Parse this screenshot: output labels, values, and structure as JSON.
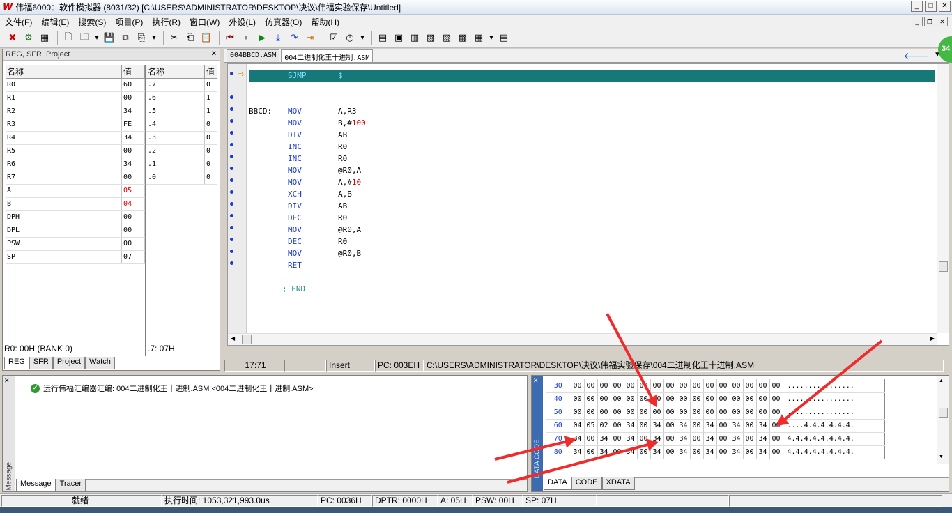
{
  "window": {
    "title": "伟福6000：软件模拟器 (8031/32) [C:\\USERS\\ADMINISTRATOR\\DESKTOP\\决议\\伟福实验保存\\Untitled]",
    "logo": "W"
  },
  "menu": [
    "文件(F)",
    "编辑(E)",
    "搜索(S)",
    "项目(P)",
    "执行(R)",
    "窗口(W)",
    "外设(L)",
    "仿真器(O)",
    "帮助(H)"
  ],
  "toolbar_icons": [
    "stop-icon",
    "gear-icon",
    "chip-icon",
    "new-file-icon",
    "open-folder-icon",
    "dropdown-icon",
    "save-icon",
    "save-all-icon",
    "project-icon",
    "dropdown-icon",
    "cut-icon",
    "copy-icon",
    "paste-icon",
    "reset-icon",
    "pause-icon",
    "run-icon",
    "step-into-icon",
    "step-over-icon",
    "run-to-cursor-icon",
    "watch-icon",
    "clock-icon",
    "dropdown-icon",
    "view-a-icon",
    "view-b-icon",
    "view-c-icon",
    "view-d-icon",
    "view-e-icon",
    "view-f-icon",
    "view-g-icon",
    "dropdown-icon",
    "view-h-icon"
  ],
  "left_panel": {
    "title": "REG, SFR, Project",
    "col_name": "名称",
    "col_value": "值",
    "registers": [
      {
        "name": "R0",
        "value": "60",
        "hl": false
      },
      {
        "name": "R1",
        "value": "00",
        "hl": false
      },
      {
        "name": "R2",
        "value": "34",
        "hl": false
      },
      {
        "name": "R3",
        "value": "FE",
        "hl": false
      },
      {
        "name": "R4",
        "value": "34",
        "hl": false
      },
      {
        "name": "R5",
        "value": "00",
        "hl": false
      },
      {
        "name": "R6",
        "value": "34",
        "hl": false
      },
      {
        "name": "R7",
        "value": "00",
        "hl": false
      },
      {
        "name": "A",
        "value": "05",
        "hl": true
      },
      {
        "name": "B",
        "value": "04",
        "hl": true
      },
      {
        "name": "DPH",
        "value": "00",
        "hl": false
      },
      {
        "name": "DPL",
        "value": "00",
        "hl": false
      },
      {
        "name": "PSW",
        "value": "00",
        "hl": false
      },
      {
        "name": "SP",
        "value": "07",
        "hl": false
      }
    ],
    "bits": [
      {
        "name": ".7",
        "value": "0"
      },
      {
        "name": ".6",
        "value": "1"
      },
      {
        "name": ".5",
        "value": "1"
      },
      {
        "name": ".4",
        "value": "0"
      },
      {
        "name": ".3",
        "value": "0"
      },
      {
        "name": ".2",
        "value": "0"
      },
      {
        "name": ".1",
        "value": "0"
      },
      {
        "name": ".0",
        "value": "0"
      }
    ],
    "status_left": "R0: 00H (BANK 0)",
    "status_right": ".7: 07H",
    "tabs": [
      "REG",
      "SFR",
      "Project",
      "Watch"
    ]
  },
  "editor": {
    "tabs": [
      "004BBCD.ASM",
      "004二进制化王十进制.ASM"
    ],
    "highlight_line": {
      "op": "SJMP",
      "arg": "$"
    },
    "label": "BBCD:",
    "lines": [
      {
        "op": "MOV",
        "a": "A,R3",
        "n": ""
      },
      {
        "op": "MOV",
        "a": "B,#",
        "n": "100"
      },
      {
        "op": "DIV",
        "a": "AB",
        "n": ""
      },
      {
        "op": "INC",
        "a": "R0",
        "n": ""
      },
      {
        "op": "INC",
        "a": "R0",
        "n": ""
      },
      {
        "op": "MOV",
        "a": "@R0,A",
        "n": ""
      },
      {
        "op": "MOV",
        "a": "A,#",
        "n": "10"
      },
      {
        "op": "XCH",
        "a": "A,B",
        "n": ""
      },
      {
        "op": "DIV",
        "a": "AB",
        "n": ""
      },
      {
        "op": "DEC",
        "a": "R0",
        "n": ""
      },
      {
        "op": "MOV",
        "a": "@R0,A",
        "n": ""
      },
      {
        "op": "DEC",
        "a": "R0",
        "n": ""
      },
      {
        "op": "MOV",
        "a": "@R0,B",
        "n": ""
      },
      {
        "op": "RET",
        "a": "",
        "n": ""
      }
    ],
    "comment": "; END"
  },
  "editor_status": {
    "pos": "17:71",
    "mode": "Insert",
    "pc": "PC: 003EH",
    "path": "C:\\USERS\\ADMINISTRATOR\\DESKTOP\\决议\\伟福实验保存\\004二进制化王十进制.ASM"
  },
  "message": {
    "text": "运行伟福汇编器汇编: 004二进制化王十进制.ASM  <004二进制化王十进制.ASM>",
    "side_label": "Message",
    "tabs": [
      "Message",
      "Tracer"
    ]
  },
  "memory": {
    "side_label": "DATA CODE",
    "rows": [
      {
        "addr": "30",
        "bytes": [
          "00",
          "00",
          "00",
          "00",
          "00",
          "00",
          "00",
          "00",
          "00",
          "00",
          "00",
          "00",
          "00",
          "00",
          "00",
          "00"
        ],
        "ascii": "................"
      },
      {
        "addr": "40",
        "bytes": [
          "00",
          "00",
          "00",
          "00",
          "00",
          "00",
          "00",
          "00",
          "00",
          "00",
          "00",
          "00",
          "00",
          "00",
          "00",
          "00"
        ],
        "ascii": "................"
      },
      {
        "addr": "50",
        "bytes": [
          "00",
          "00",
          "00",
          "00",
          "00",
          "00",
          "00",
          "00",
          "00",
          "00",
          "00",
          "00",
          "00",
          "00",
          "00",
          "00"
        ],
        "ascii": "................"
      },
      {
        "addr": "60",
        "bytes": [
          "04",
          "05",
          "02",
          "00",
          "34",
          "00",
          "34",
          "00",
          "34",
          "00",
          "34",
          "00",
          "34",
          "00",
          "34",
          "00"
        ],
        "ascii": "....4.4.4.4.4.4."
      },
      {
        "addr": "70",
        "bytes": [
          "34",
          "00",
          "34",
          "00",
          "34",
          "00",
          "34",
          "00",
          "34",
          "00",
          "34",
          "00",
          "34",
          "00",
          "34",
          "00"
        ],
        "ascii": "4.4.4.4.4.4.4.4."
      },
      {
        "addr": "80",
        "bytes": [
          "34",
          "00",
          "34",
          "00",
          "34",
          "00",
          "34",
          "00",
          "34",
          "00",
          "34",
          "00",
          "34",
          "00",
          "34",
          "00"
        ],
        "ascii": "4.4.4.4.4.4.4.4."
      }
    ],
    "tabs": [
      "DATA",
      "CODE",
      "XDATA"
    ]
  },
  "statusbar": {
    "ready": "就绪",
    "exec_time": "执行时间: 1053,321,993.0us",
    "pc": "PC: 0036H",
    "dptr": "DPTR: 0000H",
    "a": "A: 05H",
    "psw": "PSW: 00H",
    "sp": "SP: 07H"
  },
  "badge": "34"
}
